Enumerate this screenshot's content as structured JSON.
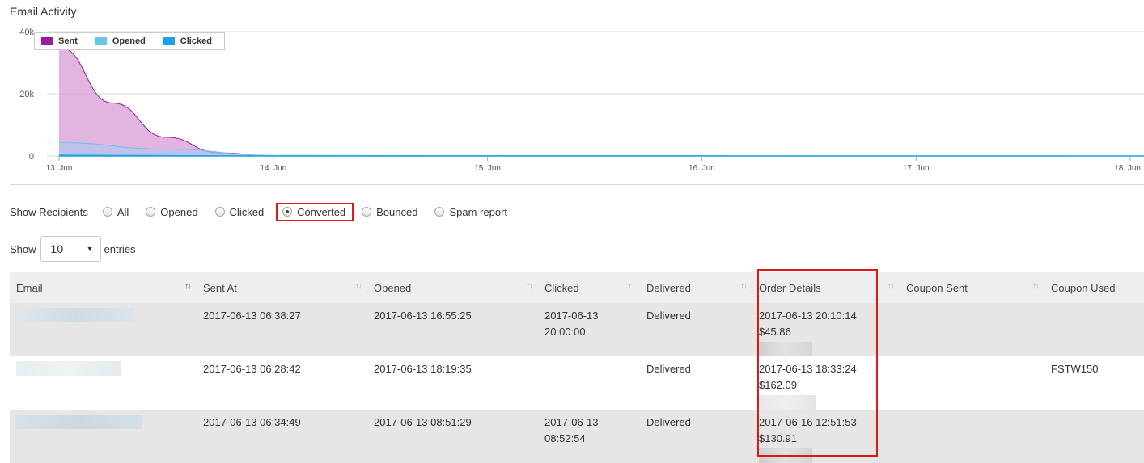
{
  "chart_title": "Email Activity",
  "chart_data": {
    "type": "area",
    "title": "Email Activity",
    "x": [
      "13. Jun",
      "14. Jun",
      "15. Jun",
      "16. Jun",
      "17. Jun",
      "18. Jun"
    ],
    "yticks": [
      "0",
      "20k",
      "40k"
    ],
    "ylim": [
      0,
      40000
    ],
    "grid": true,
    "legend_position": "top-left",
    "series": [
      {
        "name": "Sent",
        "color": "#9c1a9c",
        "fill": "#dda8da",
        "points": [
          [
            0,
            35000
          ],
          [
            0.25,
            17000
          ],
          [
            0.5,
            6000
          ],
          [
            0.75,
            1000
          ],
          [
            1,
            0
          ],
          [
            5,
            0
          ]
        ]
      },
      {
        "name": "Opened",
        "color": "#66c6ee",
        "fill": "#b0c6ef",
        "points": [
          [
            0,
            4300
          ],
          [
            0.5,
            2200
          ],
          [
            1,
            200
          ],
          [
            5,
            0
          ]
        ]
      },
      {
        "name": "Clicked",
        "color": "#1aa3e0",
        "fill": "#1aa3e0",
        "points": [
          [
            0,
            300
          ],
          [
            1,
            0
          ],
          [
            5,
            0
          ]
        ]
      }
    ]
  },
  "filters": {
    "label": "Show Recipients",
    "options": [
      "All",
      "Opened",
      "Clicked",
      "Converted",
      "Bounced",
      "Spam report"
    ],
    "selected": "Converted"
  },
  "entries": {
    "show_label": "Show",
    "value": "10",
    "suffix": "entries"
  },
  "table": {
    "columns": [
      "Email",
      "Sent At",
      "Opened",
      "Clicked",
      "Delivered",
      "Order Details",
      "Coupon Sent",
      "Coupon Used"
    ],
    "rows": [
      {
        "sent_at": "2017-06-13 06:38:27",
        "opened": "2017-06-13 16:55:25",
        "clicked_date": "2017-06-13",
        "clicked_time": "20:00:00",
        "delivered": "Delivered",
        "order_date": "2017-06-13 20:10:14",
        "order_amount": "$45.86",
        "coupon_sent": "",
        "coupon_used": ""
      },
      {
        "sent_at": "2017-06-13 06:28:42",
        "opened": "2017-06-13 18:19:35",
        "clicked_date": "",
        "clicked_time": "",
        "delivered": "Delivered",
        "order_date": "2017-06-13 18:33:24",
        "order_amount": "$162.09",
        "coupon_sent": "",
        "coupon_used": "FSTW150"
      },
      {
        "sent_at": "2017-06-13 06:34:49",
        "opened": "2017-06-13 08:51:29",
        "clicked_date": "2017-06-13",
        "clicked_time": "08:52:54",
        "delivered": "Delivered",
        "order_date": "2017-06-16 12:51:53",
        "order_amount": "$130.91",
        "coupon_sent": "",
        "coupon_used": ""
      }
    ]
  },
  "colors": {
    "highlight": "#e01818",
    "row_alt": "#e6e6e6",
    "header_bg": "#eeeeee"
  }
}
